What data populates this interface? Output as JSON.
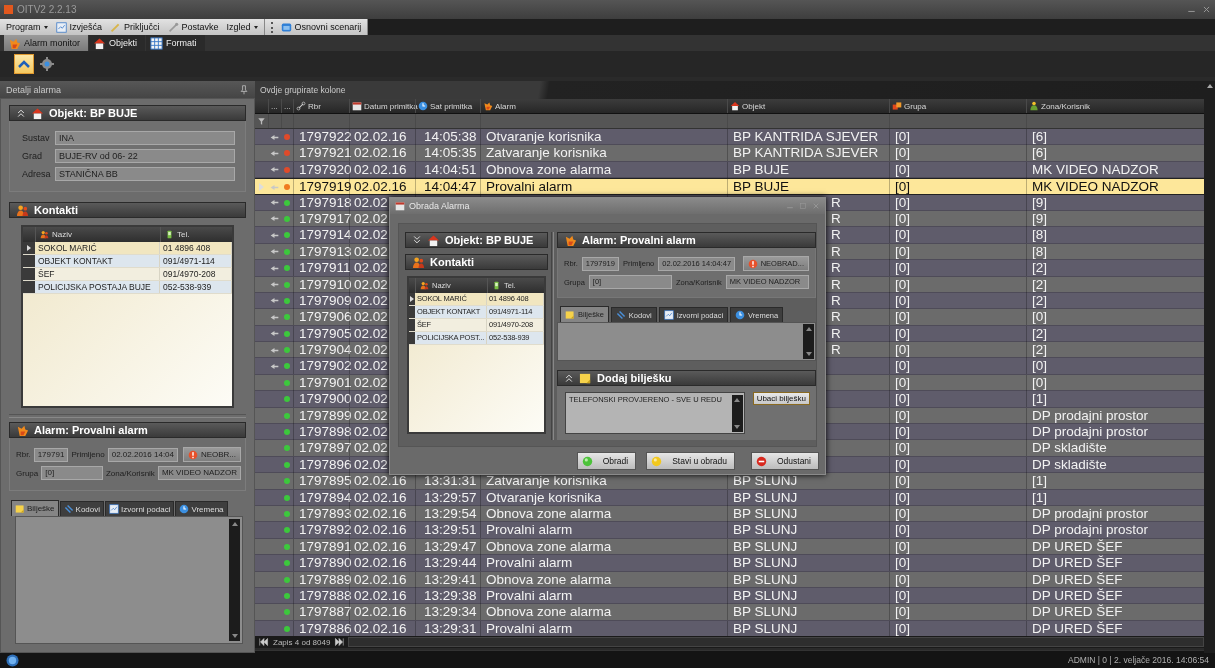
{
  "window": {
    "title": "OITV2 2.2.13"
  },
  "menu": [
    {
      "label": "Program",
      "dropdown": true
    },
    {
      "label": "Izvješća",
      "dropdown": false
    },
    {
      "label": "Priključci",
      "dropdown": false
    },
    {
      "label": "Postavke",
      "dropdown": false
    },
    {
      "label": "Izgled",
      "dropdown": true
    },
    {
      "label": "Osnovni scenarij",
      "dropdown": false
    }
  ],
  "tabs": [
    {
      "label": "Alarm monitor",
      "selected": true
    },
    {
      "label": "Objekti",
      "selected": false
    },
    {
      "label": "Formati",
      "selected": false
    }
  ],
  "toolbar": [
    {
      "selected": true
    },
    {
      "selected": false
    }
  ],
  "details": {
    "title": "Detalji alarma",
    "object": {
      "title": "Objekt: BP BUJE",
      "fields": [
        {
          "label": "Sustav",
          "value": "INA"
        },
        {
          "label": "Grad",
          "value": "BUJE-RV od 06- 22"
        },
        {
          "label": "Adresa",
          "value": "STANIČNA BB"
        }
      ]
    },
    "contacts": {
      "title": "Kontakti",
      "columns": [
        "Naziv",
        "Tel."
      ],
      "rows": [
        {
          "name": "SOKOL MARIĆ",
          "phone": "01 4896 408",
          "selected": true
        },
        {
          "name": "OBJEKT KONTAKT",
          "phone": "091/4971-114",
          "selected": false
        },
        {
          "name": "ŠEF",
          "phone": "091/4970-208",
          "selected": false
        },
        {
          "name": "POLICIJSKA POSTAJA BUJE",
          "phone": "052-538-939",
          "selected": false
        }
      ]
    },
    "alarm": {
      "title": "Alarm: Provalni alarm",
      "rbr_label": "Rbr.",
      "rbr": "179791",
      "received_label": "Primljeno",
      "received": "02.02.2016 14:04",
      "status": "NEOBR...",
      "group_label": "Grupa",
      "group": "[0]",
      "zone_label": "Zona/Korisnik",
      "zone": "MK VIDEO NADZOR"
    },
    "tabs": [
      {
        "label": "Bilješke",
        "selected": true
      },
      {
        "label": "Kodovi",
        "selected": false
      },
      {
        "label": "Izvorni podaci",
        "selected": false
      },
      {
        "label": "Vremena",
        "selected": false
      }
    ]
  },
  "grid": {
    "group_hint": "Ovdje grupirate kolone",
    "columns": [
      "...",
      "...",
      "Rbr",
      "Datum primitka",
      "Sat primitka",
      "Alarm",
      "Objekt",
      "Grupa",
      "Zona/Korisnik"
    ],
    "rows": [
      {
        "rbr": "1797922",
        "date": "02.02.16",
        "time": "14:05:38",
        "alarm": "Otvaranje korisnika",
        "object": "BP KANTRIDA SJEVER",
        "group": "[0]",
        "zone": "[6]",
        "color": "#e04a2a",
        "flagged": true,
        "selected": false
      },
      {
        "rbr": "1797921",
        "date": "02.02.16",
        "time": "14:05:35",
        "alarm": "Zatvaranje korisnika",
        "object": "BP KANTRIDA SJEVER",
        "group": "[0]",
        "zone": "[6]",
        "color": "#e04a2a",
        "flagged": true,
        "selected": false
      },
      {
        "rbr": "1797920",
        "date": "02.02.16",
        "time": "14:04:51",
        "alarm": "Obnova zone alarma",
        "object": "BP BUJE",
        "group": "[0]",
        "zone": "MK VIDEO NADZOR",
        "color": "#e04a2a",
        "flagged": true,
        "selected": false
      },
      {
        "rbr": "1797919",
        "date": "02.02.16",
        "time": "14:04:47",
        "alarm": "Provalni alarm",
        "object": "BP BUJE",
        "group": "[0]",
        "zone": "MK VIDEO NADZOR",
        "color": "#f07a20",
        "flagged": true,
        "selected": true
      },
      {
        "rbr": "1797918",
        "date": "02.02",
        "object": "R",
        "group": "[0]",
        "zone": "[9]",
        "color": "#3cc83c",
        "flagged": true,
        "selected": false
      },
      {
        "rbr": "1797917",
        "date": "02.02",
        "object": "R",
        "group": "[0]",
        "zone": "[9]",
        "color": "#3cc83c",
        "flagged": true,
        "selected": false
      },
      {
        "rbr": "1797914",
        "date": "02.02",
        "object": "R",
        "group": "[0]",
        "zone": "[8]",
        "color": "#3cc83c",
        "flagged": true,
        "selected": false
      },
      {
        "rbr": "1797913",
        "date": "02.02",
        "object": "R",
        "group": "[0]",
        "zone": "[8]",
        "color": "#3cc83c",
        "flagged": true,
        "selected": false
      },
      {
        "rbr": "1797911",
        "date": "02.02",
        "object": "R",
        "group": "[0]",
        "zone": "[2]",
        "color": "#3cc83c",
        "flagged": true,
        "selected": false
      },
      {
        "rbr": "1797910",
        "date": "02.02",
        "object": "R",
        "group": "[0]",
        "zone": "[2]",
        "color": "#3cc83c",
        "flagged": true,
        "selected": false
      },
      {
        "rbr": "1797909",
        "date": "02.02",
        "object": "R",
        "group": "[0]",
        "zone": "[2]",
        "color": "#3cc83c",
        "flagged": true,
        "selected": false
      },
      {
        "rbr": "1797906",
        "date": "02.02",
        "object": "R",
        "group": "[0]",
        "zone": "[0]",
        "color": "#3cc83c",
        "flagged": true,
        "selected": false
      },
      {
        "rbr": "1797905",
        "date": "02.02",
        "object": "R",
        "group": "[0]",
        "zone": "[2]",
        "color": "#3cc83c",
        "flagged": true,
        "selected": false
      },
      {
        "rbr": "1797904",
        "date": "02.02",
        "object": "R",
        "group": "[0]",
        "zone": "[2]",
        "color": "#3cc83c",
        "flagged": true,
        "selected": false
      },
      {
        "rbr": "1797902",
        "date": "02.02",
        "group": "[0]",
        "zone": "[0]",
        "color": "#3cc83c",
        "flagged": true,
        "selected": false
      },
      {
        "rbr": "1797901",
        "date": "02.02",
        "group": "[0]",
        "zone": "[0]",
        "color": "#3cc83c",
        "flagged": false,
        "selected": false
      },
      {
        "rbr": "1797900",
        "date": "02.02",
        "group": "[0]",
        "zone": "[1]",
        "color": "#3cc83c",
        "flagged": false,
        "selected": false
      },
      {
        "rbr": "1797899",
        "date": "02.02",
        "group": "[0]",
        "zone": "DP prodajni prostor",
        "color": "#3cc83c",
        "flagged": false,
        "selected": false
      },
      {
        "rbr": "1797898",
        "date": "02.02",
        "group": "[0]",
        "zone": "DP prodajni prostor",
        "color": "#3cc83c",
        "flagged": false,
        "selected": false
      },
      {
        "rbr": "1797897",
        "date": "02.02",
        "group": "[0]",
        "zone": "DP skladište",
        "color": "#3cc83c",
        "flagged": false,
        "selected": false
      },
      {
        "rbr": "1797896",
        "date": "02.02",
        "group": "[0]",
        "zone": "DP skladište",
        "color": "#3cc83c",
        "flagged": false,
        "selected": false
      },
      {
        "rbr": "1797895",
        "date": "02.02.16",
        "time": "13:31:31",
        "alarm": "Zatvaranje korisnika",
        "object": "BP SLUNJ",
        "group": "[0]",
        "zone": "[1]",
        "color": "#3cc83c",
        "flagged": false,
        "selected": false
      },
      {
        "rbr": "1797894",
        "date": "02.02.16",
        "time": "13:29:57",
        "alarm": "Otvaranje korisnika",
        "object": "BP SLUNJ",
        "group": "[0]",
        "zone": "[1]",
        "color": "#3cc83c",
        "flagged": false,
        "selected": false
      },
      {
        "rbr": "1797893",
        "date": "02.02.16",
        "time": "13:29:54",
        "alarm": "Obnova zone alarma",
        "object": "BP SLUNJ",
        "group": "[0]",
        "zone": "DP prodajni prostor",
        "color": "#3cc83c",
        "flagged": false,
        "selected": false
      },
      {
        "rbr": "1797892",
        "date": "02.02.16",
        "time": "13:29:51",
        "alarm": "Provalni alarm",
        "object": "BP SLUNJ",
        "group": "[0]",
        "zone": "DP prodajni prostor",
        "color": "#3cc83c",
        "flagged": false,
        "selected": false
      },
      {
        "rbr": "1797891",
        "date": "02.02.16",
        "time": "13:29:47",
        "alarm": "Obnova zone alarma",
        "object": "BP SLUNJ",
        "group": "[0]",
        "zone": "DP URED ŠEF",
        "color": "#3cc83c",
        "flagged": false,
        "selected": false
      },
      {
        "rbr": "1797890",
        "date": "02.02.16",
        "time": "13:29:44",
        "alarm": "Provalni alarm",
        "object": "BP SLUNJ",
        "group": "[0]",
        "zone": "DP URED ŠEF",
        "color": "#3cc83c",
        "flagged": false,
        "selected": false
      },
      {
        "rbr": "1797889",
        "date": "02.02.16",
        "time": "13:29:41",
        "alarm": "Obnova zone alarma",
        "object": "BP SLUNJ",
        "group": "[0]",
        "zone": "DP URED ŠEF",
        "color": "#3cc83c",
        "flagged": false,
        "selected": false
      },
      {
        "rbr": "1797888",
        "date": "02.02.16",
        "time": "13:29:38",
        "alarm": "Provalni alarm",
        "object": "BP SLUNJ",
        "group": "[0]",
        "zone": "DP URED ŠEF",
        "color": "#3cc83c",
        "flagged": false,
        "selected": false
      },
      {
        "rbr": "1797887",
        "date": "02.02.16",
        "time": "13:29:34",
        "alarm": "Obnova zone alarma",
        "object": "BP SLUNJ",
        "group": "[0]",
        "zone": "DP URED ŠEF",
        "color": "#3cc83c",
        "flagged": false,
        "selected": false
      },
      {
        "rbr": "1797886",
        "date": "02.02.16",
        "time": "13:29:31",
        "alarm": "Provalni alarm",
        "object": "BP SLUNJ",
        "group": "[0]",
        "zone": "DP URED ŠEF",
        "color": "#3cc83c",
        "flagged": false,
        "selected": false
      }
    ],
    "navigator": "Zapis 4 od 8049"
  },
  "dialog": {
    "title": "Obrada Alarma",
    "object_title": "Objekt: BP BUJE",
    "contacts": {
      "title": "Kontakti",
      "columns": [
        "Naziv",
        "Tel."
      ],
      "rows": [
        {
          "name": "SOKOL MARIĆ",
          "phone": "01 4896 408",
          "selected": true
        },
        {
          "name": "OBJEKT KONTAKT",
          "phone": "091/4971-114",
          "selected": false
        },
        {
          "name": "ŠEF",
          "phone": "091/4970-208",
          "selected": false
        },
        {
          "name": "POLICIJSKA POST...",
          "phone": "052-538-939",
          "selected": false
        }
      ]
    },
    "alarm": {
      "title": "Alarm: Provalni alarm",
      "rbr_label": "Rbr.",
      "rbr": "1797919",
      "received_label": "Primljeno",
      "received": "02.02.2016 14:04:47",
      "status": "NEOBRAD...",
      "group_label": "Grupa",
      "group": "[0]",
      "zone_label": "Zona/Korisnik",
      "zone": "MK VIDEO NADZOR"
    },
    "tabs": [
      {
        "label": "Bilješke",
        "selected": true
      },
      {
        "label": "Kodovi",
        "selected": false
      },
      {
        "label": "Izvorni podaci",
        "selected": false
      },
      {
        "label": "Vremena",
        "selected": false
      }
    ],
    "note_title": "Dodaj bilješku",
    "note": "TELEFONSKI PROVJERENO - SVE U REDU",
    "insert_button": "Ubaci bilješku",
    "buttons": [
      "Obradi",
      "Stavi u obradu",
      "Odustani"
    ]
  },
  "status_bar": {
    "text": "ADMIN | 0 | 2. veljače 2016. 14:06:54"
  }
}
